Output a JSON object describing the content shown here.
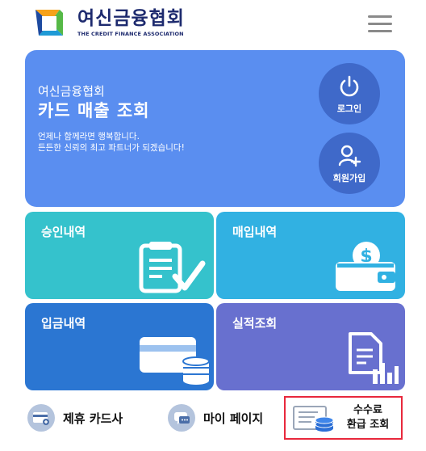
{
  "header": {
    "brand_name": "여신금융협회",
    "brand_subtitle": "THE CREDIT FINANCE ASSOCIATION"
  },
  "hero": {
    "org": "여신금융협회",
    "title": "카드 매출 조회",
    "desc_line1": "언제나 함께라면 행복합니다.",
    "desc_line2": "든든한 신뢰의 최고 파트너가 되겠습니다!",
    "login_label": "로그인",
    "join_label": "회원가입"
  },
  "tiles": {
    "approval": "승인내역",
    "purchase": "매입내역",
    "deposit": "입금내역",
    "performance": "실적조회"
  },
  "bottom": {
    "partner_card": "제휴 카드사",
    "my_page": "마이 페이지",
    "refund_line1": "수수료",
    "refund_line2": "환급 조회"
  },
  "colors": {
    "hero": "#5a8ef0",
    "approval": "#35c2cc",
    "purchase": "#31b1e2",
    "deposit": "#2b76d2",
    "performance": "#6870cf",
    "highlight": "#e8283c"
  },
  "icons": {
    "logo": "ribbon-square-logo",
    "menu": "hamburger-icon",
    "login": "power-icon",
    "join": "add-user-icon",
    "approval": "clipboard-check-icon",
    "purchase": "wallet-dollar-icon",
    "deposit": "card-coins-icon",
    "performance": "document-chart-icon",
    "partner": "card-icon",
    "mypage": "chat-icon",
    "refund": "document-coins-icon"
  }
}
